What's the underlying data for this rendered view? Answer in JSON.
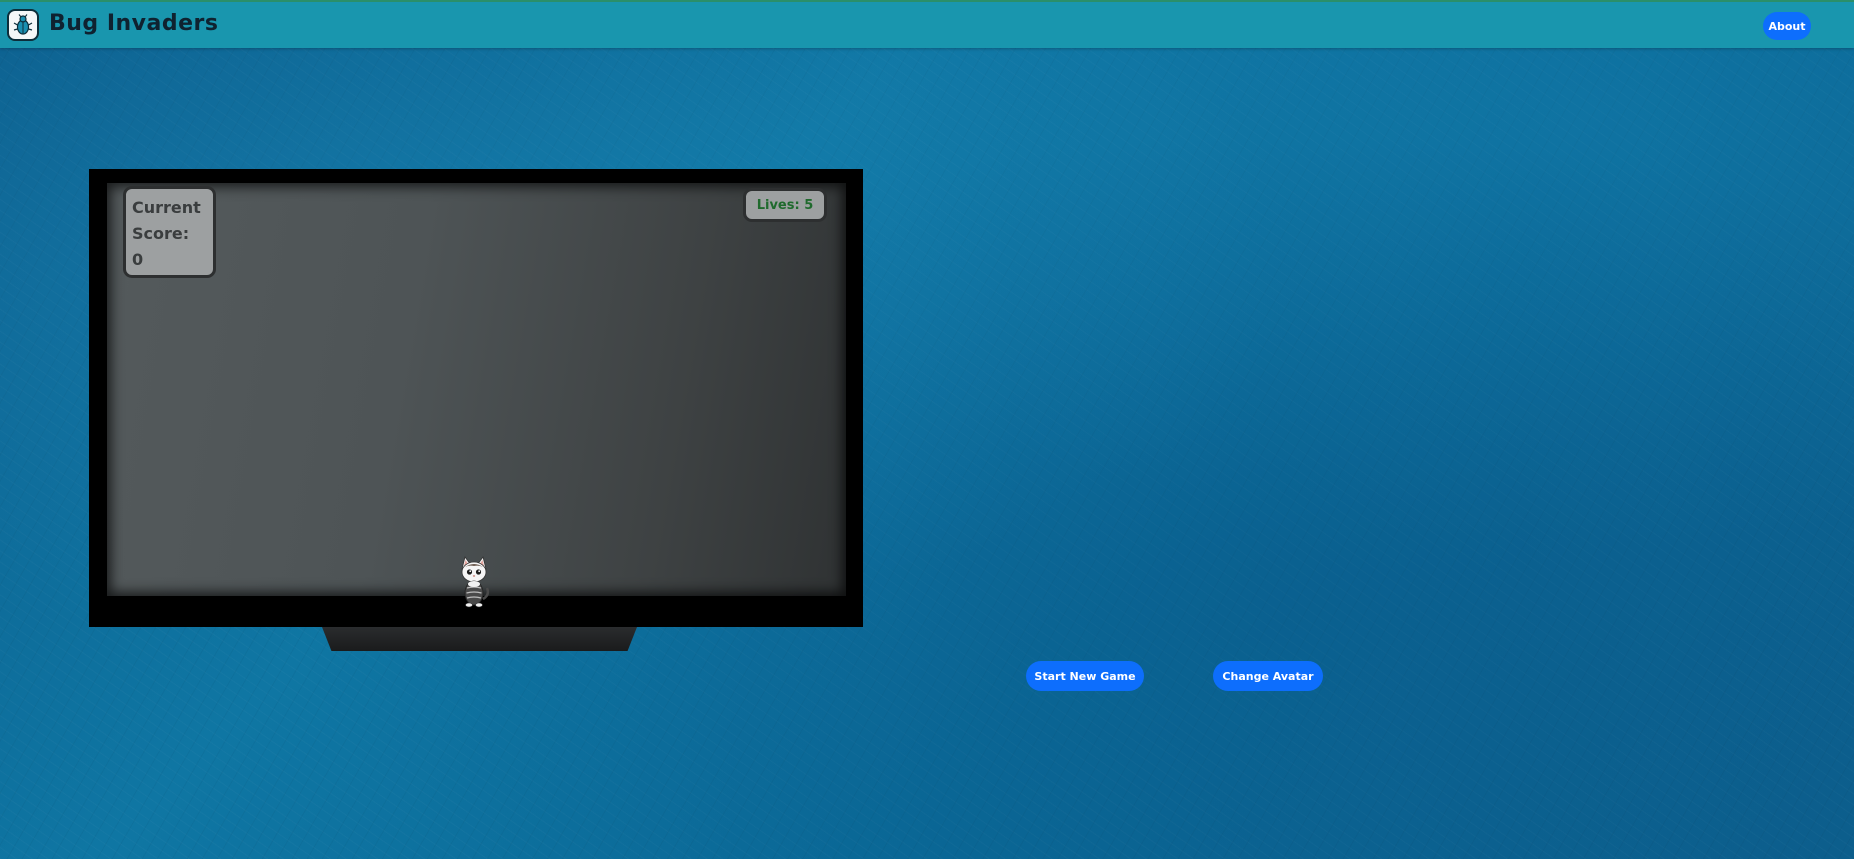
{
  "app": {
    "title": "Bug Invaders",
    "logo_icon": "bug-icon"
  },
  "nav": {
    "about_label": "About"
  },
  "game": {
    "score_label": "Current Score:",
    "score_value": "0",
    "lives_label": "Lives:",
    "lives_value": "5",
    "avatar_icon": "cat-avatar-icon"
  },
  "controls": {
    "start_label": "Start New Game",
    "change_avatar_label": "Change Avatar"
  },
  "colors": {
    "navbar": "#1996ae",
    "button": "#0d6efd",
    "lives_text": "#1f6a2d",
    "background": "#0f76a3"
  }
}
